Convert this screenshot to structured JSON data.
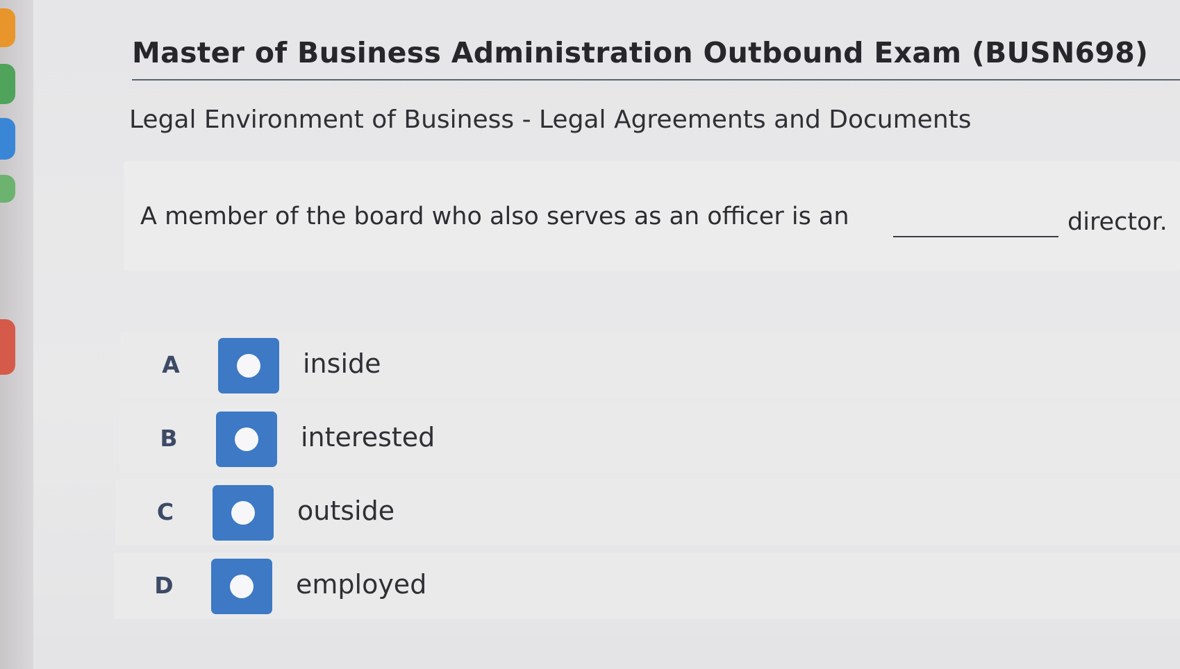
{
  "exam": {
    "title": "Master of Business Administration Outbound Exam (BUSN698)",
    "subtitle": "Legal Environment of Business - Legal Agreements and Documents"
  },
  "question": {
    "text_before_blank": "A member of the board who also serves as an officer is an",
    "text_after_blank": "director."
  },
  "options": [
    {
      "letter": "A",
      "label": "inside"
    },
    {
      "letter": "B",
      "label": "interested"
    },
    {
      "letter": "C",
      "label": "outside"
    },
    {
      "letter": "D",
      "label": "employed"
    }
  ],
  "colors": {
    "radio_button": "#3d79c4",
    "option_letter": "#3d4a66"
  },
  "icons": {
    "radio": "radio-circle-icon"
  }
}
